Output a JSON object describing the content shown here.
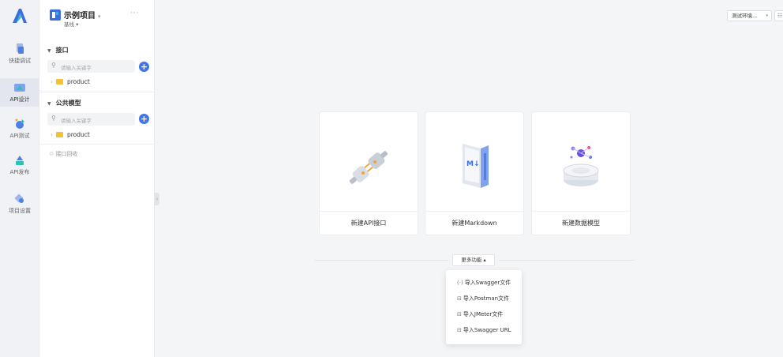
{
  "rail": {
    "items": [
      {
        "label": "快捷调试",
        "icon": "quick-debug-icon"
      },
      {
        "label": "API设计",
        "icon": "api-design-icon"
      },
      {
        "label": "API测试",
        "icon": "api-test-icon"
      },
      {
        "label": "API发布",
        "icon": "api-publish-icon"
      },
      {
        "label": "项目设置",
        "icon": "project-settings-icon"
      }
    ],
    "active_index": 1
  },
  "project": {
    "title": "示例项目",
    "title_caret": "▾",
    "branch": "基线 ▾",
    "more": "···"
  },
  "sections": [
    {
      "heading": "接口",
      "search_placeholder": "请输入关键字",
      "folder": "product"
    },
    {
      "heading": "公共模型",
      "search_placeholder": "请输入关键字",
      "folder": "product"
    }
  ],
  "recycle_bin": "接口回收",
  "env": {
    "value": "测试环境...",
    "caret": "▾",
    "btn": "☷"
  },
  "cards": [
    {
      "label": "新建API接口",
      "icon": "api-plug-icon"
    },
    {
      "label": "新建Markdown",
      "icon": "markdown-book-icon"
    },
    {
      "label": "新建数据模型",
      "icon": "data-model-icon"
    }
  ],
  "more": {
    "label": "更多功能 ▴"
  },
  "menu": [
    {
      "icon": "(·)",
      "label": "导入Swagger文件"
    },
    {
      "icon": "⊟",
      "label": "导入Postman文件"
    },
    {
      "icon": "⊟",
      "label": "导入JMeter文件"
    },
    {
      "icon": "⊟",
      "label": "导入Swagger URL"
    }
  ],
  "colors": {
    "accent": "#4574e3",
    "folder": "#f2c230"
  }
}
